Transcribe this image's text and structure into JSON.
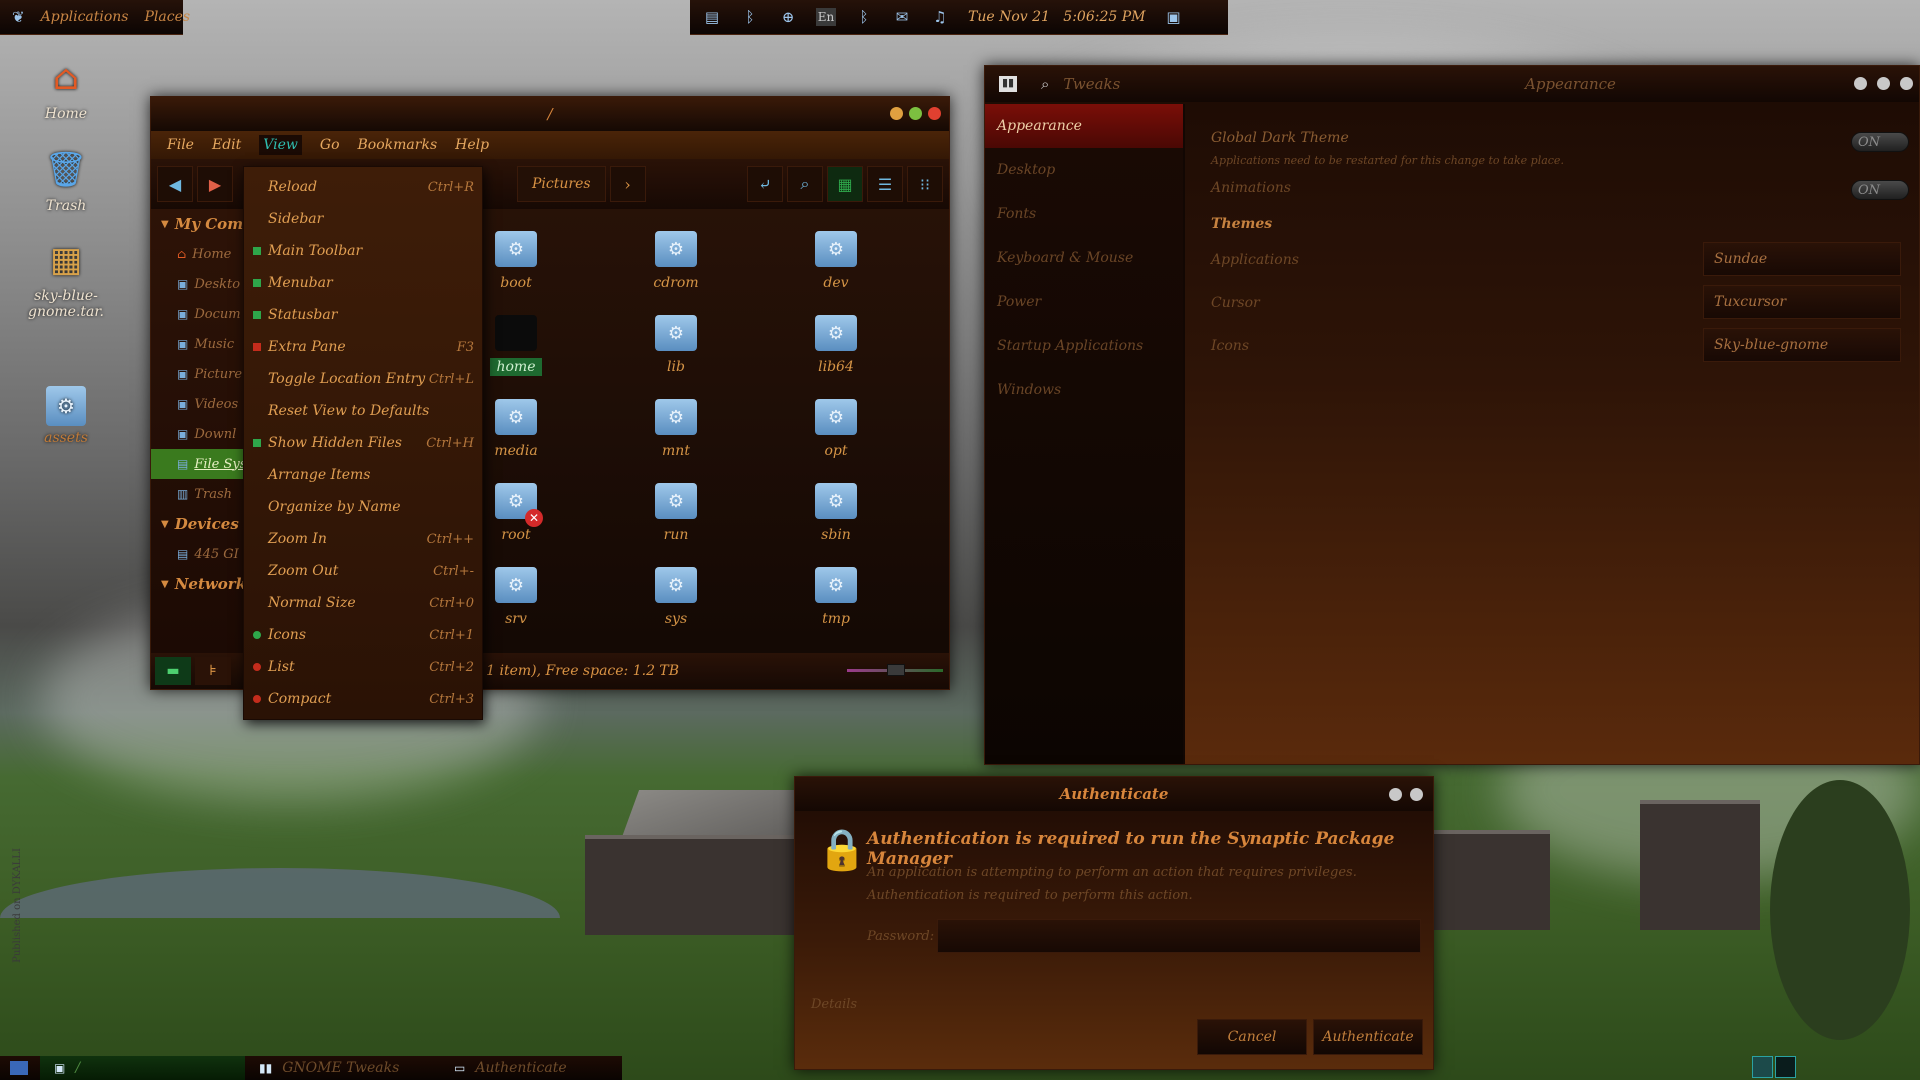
{
  "top_panel": {
    "applications": "Applications",
    "places": "Places",
    "datetime": "Tue Nov 21   5:06:25 PM",
    "keyboard": "En"
  },
  "desktop_icons": [
    {
      "label": "Home"
    },
    {
      "label": "Trash"
    },
    {
      "label": "sky-blue-gnome.tar."
    },
    {
      "label": "assets"
    }
  ],
  "file_manager": {
    "title": "/",
    "menus": [
      "File",
      "Edit",
      "View",
      "Go",
      "Bookmarks",
      "Help"
    ],
    "breadcrumb": "Pictures",
    "sidebar": {
      "my_computer": "My Comp",
      "devices": "Devices",
      "network": "Network",
      "items": [
        "Home",
        "Deskto",
        "Docum",
        "Music",
        "Picture",
        "Videos",
        "Downl",
        "File Sys",
        "Trash"
      ],
      "device_items": [
        "445 GI"
      ]
    },
    "files": [
      "boot",
      "cdrom",
      "dev",
      "home",
      "lib",
      "lib64",
      "media",
      "mnt",
      "opt",
      "root",
      "run",
      "sbin",
      "srv",
      "sys",
      "tmp"
    ],
    "status": "(containing 1 item), Free space: 1.2 TB"
  },
  "view_menu": [
    {
      "label": "Reload",
      "accel": "Ctrl+R",
      "mark": ""
    },
    {
      "label": "Sidebar",
      "accel": "",
      "mark": ""
    },
    {
      "label": "Main Toolbar",
      "accel": "",
      "mark": "g"
    },
    {
      "label": "Menubar",
      "accel": "",
      "mark": "g"
    },
    {
      "label": "Statusbar",
      "accel": "",
      "mark": "g"
    },
    {
      "label": "Extra Pane",
      "accel": "F3",
      "mark": "r"
    },
    {
      "label": "Toggle Location Entry",
      "accel": "Ctrl+L",
      "mark": ""
    },
    {
      "label": "Reset View to Defaults",
      "accel": "",
      "mark": ""
    },
    {
      "label": "Show Hidden Files",
      "accel": "Ctrl+H",
      "mark": "g"
    },
    {
      "label": "Arrange Items",
      "accel": "",
      "mark": ""
    },
    {
      "label": "Organize by Name",
      "accel": "",
      "mark": ""
    },
    {
      "label": "Zoom In",
      "accel": "Ctrl++",
      "mark": ""
    },
    {
      "label": "Zoom Out",
      "accel": "Ctrl+-",
      "mark": ""
    },
    {
      "label": "Normal Size",
      "accel": "Ctrl+0",
      "mark": ""
    },
    {
      "label": "Icons",
      "accel": "Ctrl+1",
      "mark": "rg"
    },
    {
      "label": "List",
      "accel": "Ctrl+2",
      "mark": "rr"
    },
    {
      "label": "Compact",
      "accel": "Ctrl+3",
      "mark": "rr"
    }
  ],
  "tweaks": {
    "app_title": "Tweaks",
    "section_title": "Appearance",
    "sections": [
      "Appearance",
      "Desktop",
      "Fonts",
      "Keyboard & Mouse",
      "Power",
      "Startup Applications",
      "Windows"
    ],
    "global_dark_theme": "Global Dark Theme",
    "restart_note": "Applications need to be restarted for this change to take place.",
    "animations": "Animations",
    "toggle_on": "ON",
    "themes_heading": "Themes",
    "rows": [
      {
        "label": "Applications",
        "value": "Sundae"
      },
      {
        "label": "Cursor",
        "value": "Tuxcursor"
      },
      {
        "label": "Icons",
        "value": "Sky-blue-gnome"
      }
    ]
  },
  "auth": {
    "title": "Authenticate",
    "heading": "Authentication is required to run the Synaptic Package Manager",
    "line1": "An application is attempting to perform an action that requires privileges.",
    "line2": "Authentication is required to perform this action.",
    "password_label": "Password:",
    "details": "Details",
    "cancel": "Cancel",
    "authenticate": "Authenticate"
  },
  "taskbar": {
    "items": [
      "/",
      "GNOME Tweaks",
      "Authenticate"
    ]
  },
  "watermark": "Published on DYKALLI"
}
